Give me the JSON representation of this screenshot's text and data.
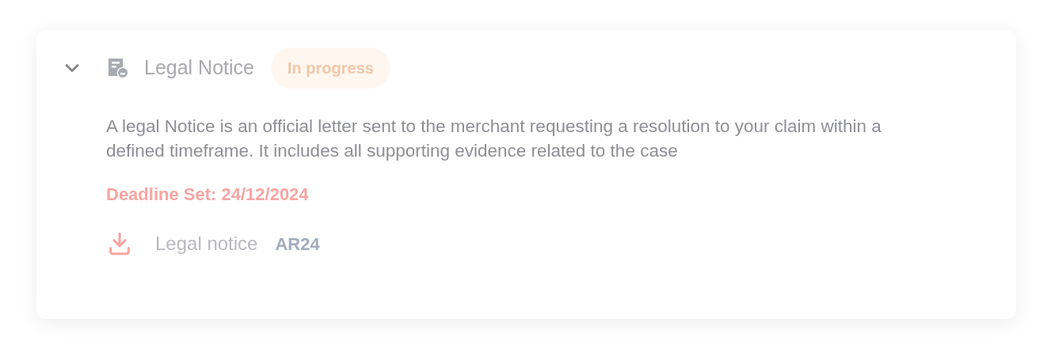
{
  "card": {
    "expanded": true,
    "title": "Legal Notice",
    "status": "In progress",
    "description": "A legal Notice is an official letter sent to the merchant requesting a resolution to your claim within a defined timeframe. It includes all supporting evidence related to the case",
    "deadline": "Deadline Set: 24/12/2024",
    "attachment": {
      "label": "Legal notice",
      "provider": "AR24"
    }
  }
}
